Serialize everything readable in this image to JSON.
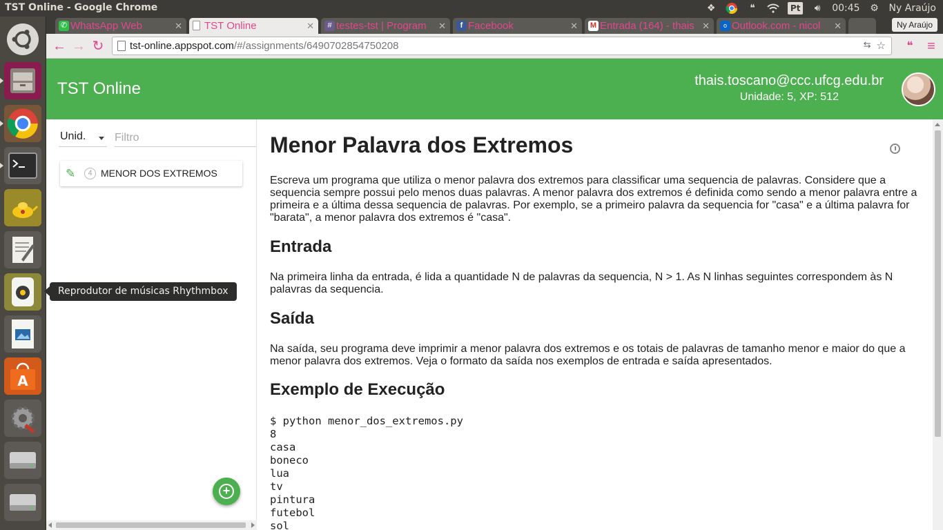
{
  "os": {
    "window_title": "TST Online - Google Chrome",
    "clock": "00:45",
    "user": "Ny Araújo",
    "keyboard_layout": "Pt",
    "launcher_tooltip": "Reprodutor de músicas Rhythmbox"
  },
  "browser": {
    "tabs": [
      {
        "label": "WhatsApp Web",
        "icon": "whatsapp-icon"
      },
      {
        "label": "TST Online",
        "icon": "page-icon"
      },
      {
        "label": "testes-tst | Program",
        "icon": "hash-icon"
      },
      {
        "label": "Facebook",
        "icon": "facebook-icon"
      },
      {
        "label": "Entrada (164) - thais",
        "icon": "gmail-icon"
      },
      {
        "label": "Outlook.com - nicol",
        "icon": "outlook-icon"
      }
    ],
    "profile_name": "Ny Araújo",
    "url_host": "tst-online.appspot.com",
    "url_path": "/#/assignments/6490702854750208",
    "accent_color": "#e0478f"
  },
  "app": {
    "title": "TST Online",
    "brand_color": "#4caf50",
    "user_email": "thais.toscano@ccc.ufcg.edu.br",
    "user_stats": "Unidade: 5, XP: 512",
    "sidebar": {
      "unit_label": "Unid.",
      "filter_placeholder": "Filtro",
      "assignments": [
        {
          "number": "4",
          "label": "MENOR DOS EXTREMOS"
        }
      ]
    },
    "assignment": {
      "title": "Menor Palavra dos Extremos",
      "description": "Escreva um programa que utiliza o menor palavra dos extremos para classificar uma sequencia de palavras. Considere que a sequencia sempre possui pelo menos duas palavras. A menor palavra dos extremos é definida como sendo a menor palavra entre a primeira e a última dessa sequencia de palavras. Por exemplo, se a primeiro palavra da sequencia for \"casa\" e a última palavra for \"barata\", a menor palavra dos extremos é \"casa\".",
      "input_heading": "Entrada",
      "input_text": "Na primeira linha da entrada, é lida a quantidade N de palavras da sequencia, N > 1. As N linhas seguintes correspondem às N palavras da sequencia.",
      "output_heading": "Saída",
      "output_text": "Na saída, seu programa deve imprimir a menor palavra dos extremos e os totais de palavras de tamanho menor e maior do que a menor palavra dos extremos. Veja o formato da saída nos exemplos de entrada e saída apresentados.",
      "example_heading": "Exemplo de Execução",
      "example_code": "$ python menor_dos_extremos.py\n8\ncasa\nboneco\nlua\ntv\npintura\nfutebol\nsol"
    }
  }
}
